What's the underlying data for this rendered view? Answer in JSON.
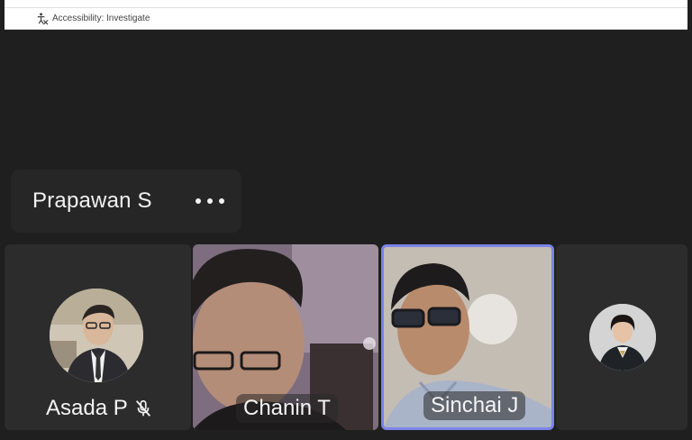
{
  "status_bar": {
    "accessibility_text": "Accessibility: Investigate"
  },
  "pinned_participant": {
    "name": "Prapawan S",
    "menu_icon": "more-horizontal-icon"
  },
  "participants": [
    {
      "name": "Asada P",
      "muted": true,
      "mic_icon": "mic-off-icon",
      "has_video": false
    },
    {
      "name": "Chanin T",
      "muted": false,
      "has_video": true
    },
    {
      "name": "Sinchai J",
      "muted": false,
      "has_video": true,
      "active_speaker": true
    },
    {
      "name": "",
      "has_video": false
    }
  ],
  "colors": {
    "background": "#1f1f1f",
    "tile": "#2c2c2c",
    "active_speaker_border": "#7b83e8",
    "text": "#f4f4f4"
  }
}
